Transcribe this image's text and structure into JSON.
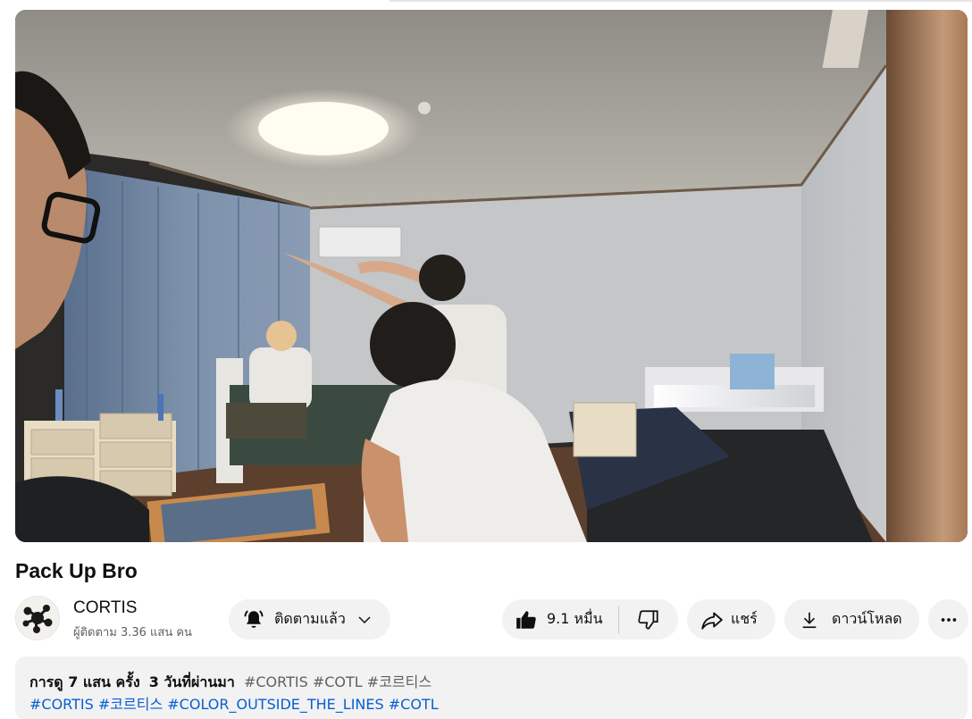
{
  "video": {
    "title": "Pack Up Bro"
  },
  "channel": {
    "name": "CORTIS",
    "subscribers": "ผู้ติดตาม 3.36 แสน คน"
  },
  "actions": {
    "subscribe_label": "ติดตามแล้ว",
    "likes": "9.1 หมื่น",
    "share_label": "แชร์",
    "download_label": "ดาวน์โหลด",
    "more_label": "⋯"
  },
  "description": {
    "views": "การดู 7 แสน ครั้ง",
    "age": "3 วันที่ผ่านมา",
    "top_tags": [
      "#CORTIS",
      "#COTL",
      "#코르티스"
    ],
    "body_tags": [
      "#CORTIS",
      "#코르티스",
      "#COLOR_OUTSIDE_THE_LINES",
      "#COTL"
    ]
  },
  "icons": {
    "subscribe": "bell-ringing-icon",
    "subscribe_menu": "chevron-down-icon",
    "like": "thumbs-up-icon",
    "dislike": "thumbs-down-icon",
    "share": "share-arrow-icon",
    "download": "download-icon",
    "more": "more-horizontal-icon",
    "avatar": "cortis-logo"
  },
  "colors": {
    "link": "#065fd4",
    "pill_bg": "#f2f2f2",
    "secondary_text": "#606060"
  }
}
